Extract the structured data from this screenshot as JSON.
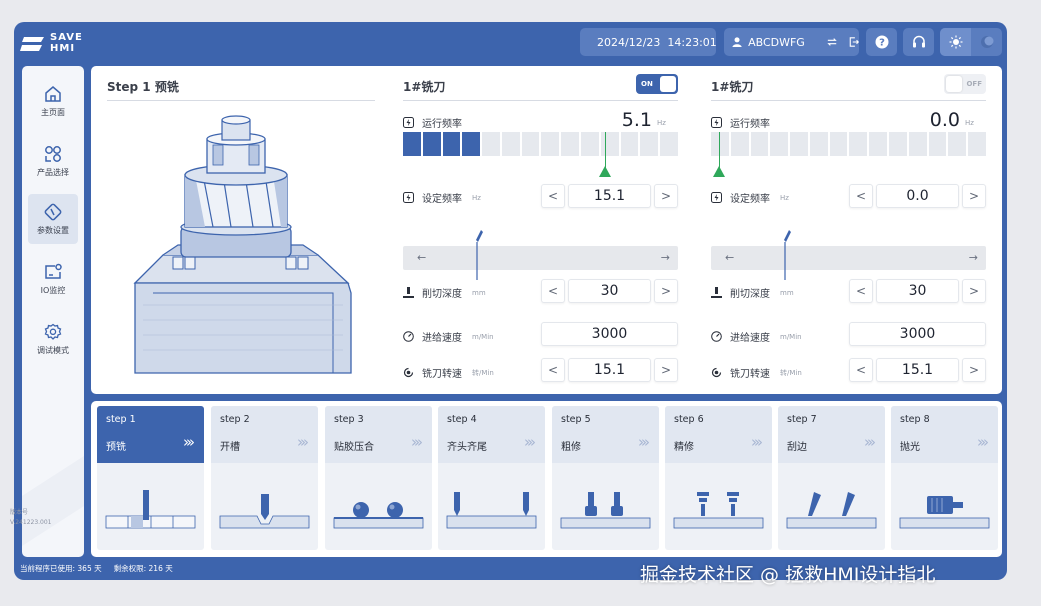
{
  "header": {
    "logo_top": "SAVE",
    "logo_bottom": "HMI",
    "datetime": "2024/12/23  14:23:01",
    "username": "ABCDWFG"
  },
  "sidebar": {
    "items": [
      {
        "label": "主页面",
        "icon": "home-icon"
      },
      {
        "label": "产品选择",
        "icon": "product-icon"
      },
      {
        "label": "参数设置",
        "icon": "params-icon"
      },
      {
        "label": "IO监控",
        "icon": "io-monitor-icon"
      },
      {
        "label": "调试模式",
        "icon": "gear-icon"
      }
    ],
    "active_index": 2,
    "version_label": "版本号",
    "version_value": "V.241223.001"
  },
  "footer": {
    "used": "当前程序已使用: 365 天",
    "remaining": "剩余权限: 216 天"
  },
  "main": {
    "step_title": "Step 1 预铣",
    "columns": [
      {
        "title": "1#铣刀",
        "toggle": "ON",
        "toggle_on": true,
        "run_freq_label": "运行频率",
        "run_freq_value": "5.1",
        "run_freq_unit": "Hz",
        "bar_fill_segments": 4,
        "bar_total_segments": 14,
        "marker_fraction": 0.75,
        "set_freq_label": "设定频率",
        "set_freq_unit": "Hz",
        "set_freq_value": "15.1",
        "slider_fraction": 0.27,
        "depth_label": "削切深度",
        "depth_unit": "mm",
        "depth_value": "30",
        "feed_label": "进给速度",
        "feed_unit": "m/Min",
        "feed_value": "3000",
        "spindle_label": "铣刀转速",
        "spindle_unit": "转/Min",
        "spindle_value": "15.1"
      },
      {
        "title": "1#铣刀",
        "toggle": "OFF",
        "toggle_on": false,
        "run_freq_label": "运行频率",
        "run_freq_value": "0.0",
        "run_freq_unit": "Hz",
        "bar_fill_segments": 0,
        "bar_total_segments": 14,
        "marker_fraction": 0.0,
        "set_freq_label": "设定频率",
        "set_freq_unit": "Hz",
        "set_freq_value": "0.0",
        "slider_fraction": 0.27,
        "depth_label": "削切深度",
        "depth_unit": "mm",
        "depth_value": "30",
        "feed_label": "进给速度",
        "feed_unit": "m/Min",
        "feed_value": "3000",
        "spindle_label": "铣刀转速",
        "spindle_unit": "转/Min",
        "spindle_value": "15.1"
      }
    ],
    "stepper_dec": "<",
    "stepper_inc": ">",
    "slider_left_arrow": "←",
    "slider_right_arrow": "→"
  },
  "steps": [
    {
      "num": "step 1",
      "name": "预铣",
      "chev": "›››"
    },
    {
      "num": "step 2",
      "name": "开槽",
      "chev": "›››"
    },
    {
      "num": "step 3",
      "name": "贴胶压合",
      "chev": "›››"
    },
    {
      "num": "step 4",
      "name": "齐头齐尾",
      "chev": "›››"
    },
    {
      "num": "step 5",
      "name": "粗修",
      "chev": "›››"
    },
    {
      "num": "step 6",
      "name": "精修",
      "chev": "›››"
    },
    {
      "num": "step 7",
      "name": "刮边",
      "chev": "›››"
    },
    {
      "num": "step 8",
      "name": "抛光",
      "chev": "›››"
    }
  ],
  "active_step": 0,
  "watermark": "掘金技术社区 @ 拯救HMI设计指北",
  "colors": {
    "brand": "#3d64ad",
    "marker": "#2fa85a"
  }
}
